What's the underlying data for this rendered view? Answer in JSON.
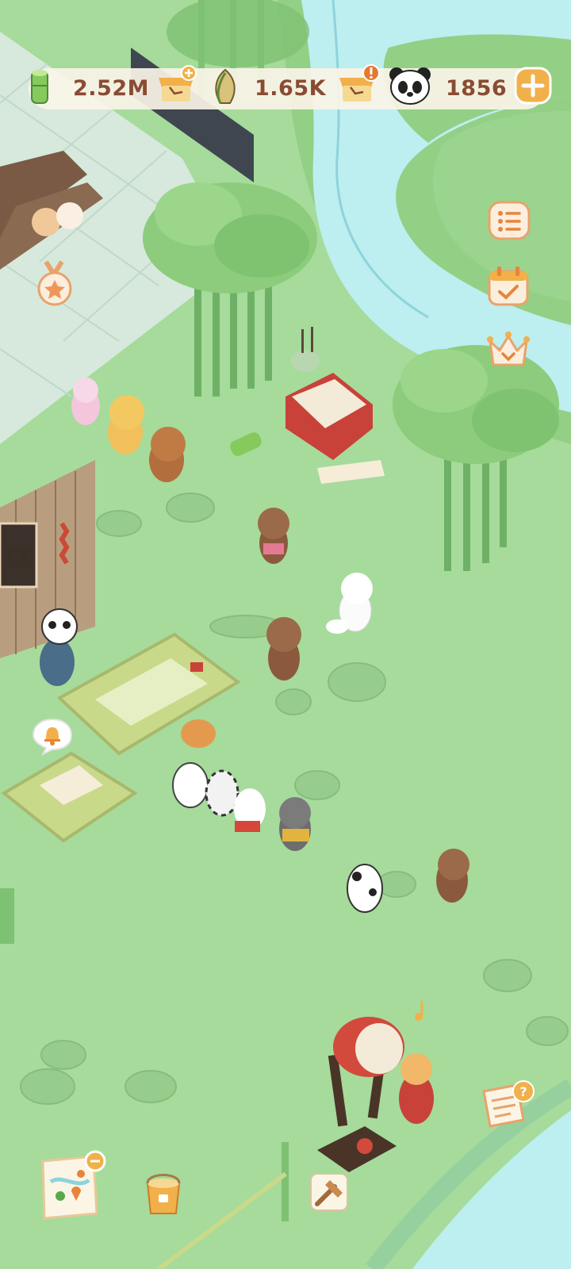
{
  "resources": {
    "bamboo": {
      "value": "2.52M",
      "icon": "bamboo-icon"
    },
    "shoots": {
      "value": "1.65K",
      "icon": "bamboo-shoot-icon"
    },
    "pandas": {
      "value": "1856",
      "icon": "panda-face-icon"
    }
  },
  "side_menu": [
    {
      "name": "list-menu-icon"
    },
    {
      "name": "calendar-checkin-icon"
    },
    {
      "name": "crown-ranking-icon"
    }
  ],
  "sign": {
    "text": "ㄗ 天"
  },
  "colors": {
    "grass": "#a8dc9c",
    "river": "#bdeef0",
    "value_text": "#8a4b32",
    "accent": "#f2b04a"
  }
}
